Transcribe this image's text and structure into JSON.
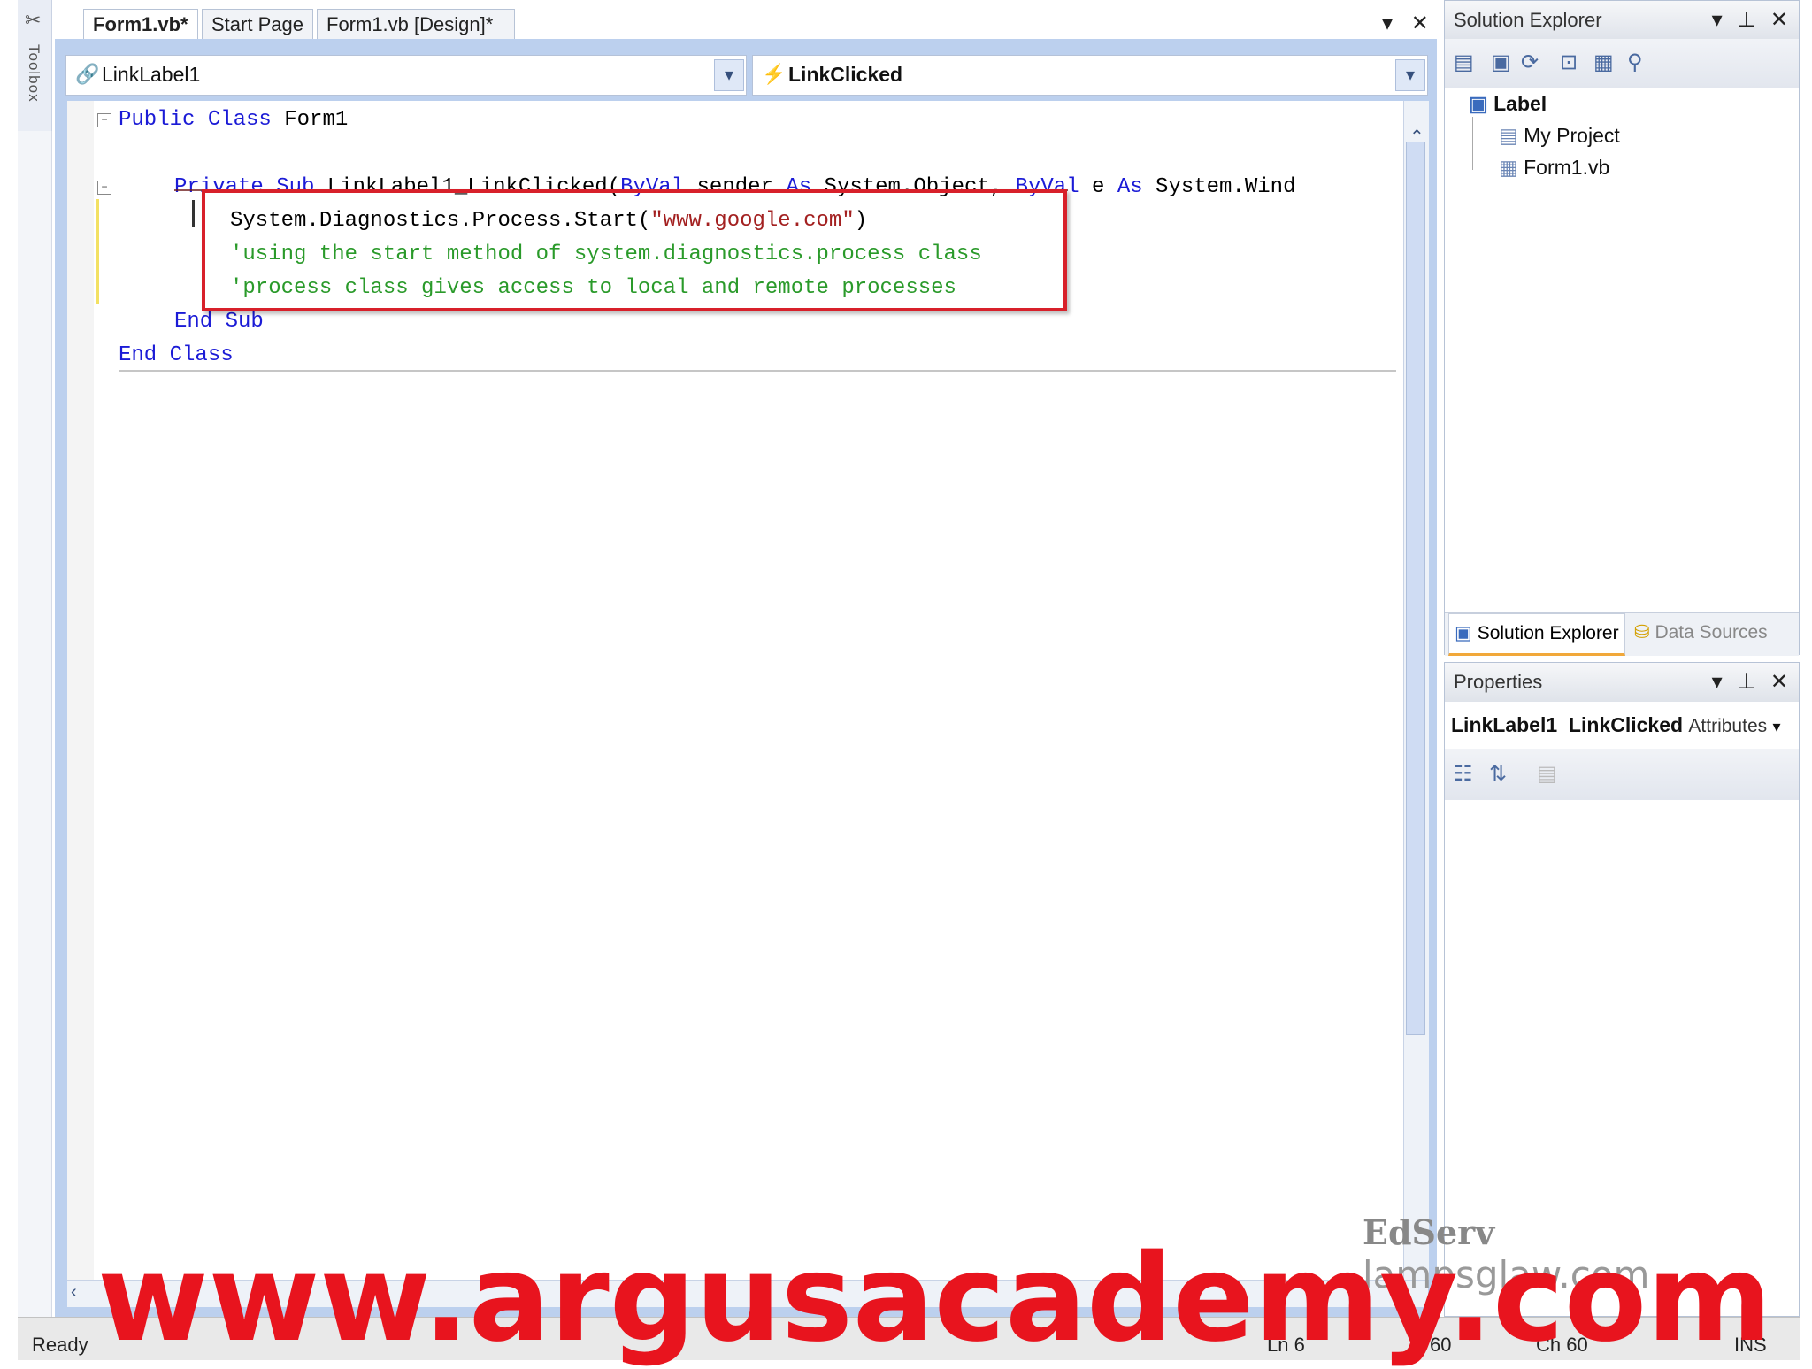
{
  "toolbox": {
    "label": "Toolbox"
  },
  "tabs": [
    {
      "label": "Form1.vb*"
    },
    {
      "label": "Start Page"
    },
    {
      "label": "Form1.vb [Design]*"
    }
  ],
  "tab_controls": {
    "dropdown": "▾",
    "close": "✕"
  },
  "object_combo": {
    "value": "LinkLabel1"
  },
  "event_combo": {
    "value": "LinkClicked"
  },
  "code": {
    "line1_kw": "Public Class",
    "line1_rest": " Form1",
    "line2_kw1": "Private Sub",
    "line2_name": " LinkLabel1_LinkClicked(",
    "line2_kw2": "ByVal",
    "line2_sender": " sender ",
    "line2_kw3": "As",
    "line2_type": " System.Object",
    "line2_comma": ", ",
    "line2_kw4": "ByVal",
    "line2_e": " e ",
    "line2_kw5": "As",
    "line2_tail": " System.Wind",
    "line3_a": "System.Diagnostics.Process.Start(",
    "line3_str": "\"www.google.com\"",
    "line3_b": ")",
    "line4": "'using the start method of system.diagnostics.process class",
    "line5": "'process class gives access to local and remote processes",
    "line6": "End Sub",
    "line7": "End Class"
  },
  "solution_explorer": {
    "title": "Solution Explorer",
    "root": "Label",
    "items": [
      "My Project",
      "Form1.vb"
    ],
    "tab_solution": "Solution Explorer",
    "tab_data": "Data Sources"
  },
  "properties": {
    "title": "Properties",
    "object": "LinkLabel1_LinkClicked",
    "object_type": "Attributes"
  },
  "status": {
    "ready": "Ready",
    "ln": "Ln 6",
    "col": "60",
    "ch": "Ch 60",
    "ins": "INS"
  },
  "watermarks": {
    "edserv": "EdServ",
    "lamp": "lampsglaw.com",
    "argus": "www.argusacademy.com"
  },
  "colors": {
    "keyword": "#1b1bd6",
    "comment": "#2a9a2a",
    "string": "#a32020",
    "highlight_box": "#d8202a",
    "watermark": "#e8141e"
  }
}
